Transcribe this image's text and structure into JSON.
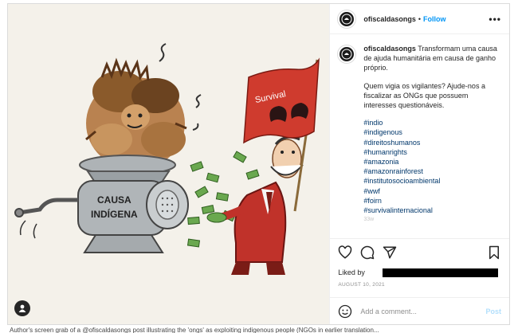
{
  "header": {
    "username": "ofiscaldasongs",
    "separator": "•",
    "follow_label": "Follow",
    "more_label": "•••"
  },
  "image": {
    "flag_text": "Survival",
    "machine_text_line1": "CAUSA",
    "machine_text_line2": "INDÍGENA"
  },
  "caption": {
    "username": "ofiscaldasongs",
    "text1": "Transformam uma causa de ajuda humanitária em causa de ganho próprio.",
    "text2": "Quem vigia os vigilantes? Ajude-nos a fiscalizar as ONGs que possuem interesses questionáveis.",
    "hashtags": [
      "#indio",
      "#indigenous",
      "#direitoshumanos",
      "#humanrights",
      "#amazonia",
      "#amazonrainforest",
      "#institutosocioambiental",
      "#wwf",
      "#foirn",
      "#survivalinternacional"
    ],
    "partial": "33w"
  },
  "icons": {
    "like": "heart-icon",
    "comment": "comment-icon",
    "share": "send-icon",
    "save": "bookmark-icon",
    "emoji": "emoji-icon",
    "tag": "user-tag-icon"
  },
  "likes": {
    "label": "Liked by"
  },
  "date": "AUGUST 10, 2021",
  "comment": {
    "placeholder": "Add a comment...",
    "post_label": "Post"
  },
  "footer": "Author's screen grab of a @ofiscaldasongs post illustrating the 'ongs' as exploiting indigenous people (NGOs in earlier translation..."
}
